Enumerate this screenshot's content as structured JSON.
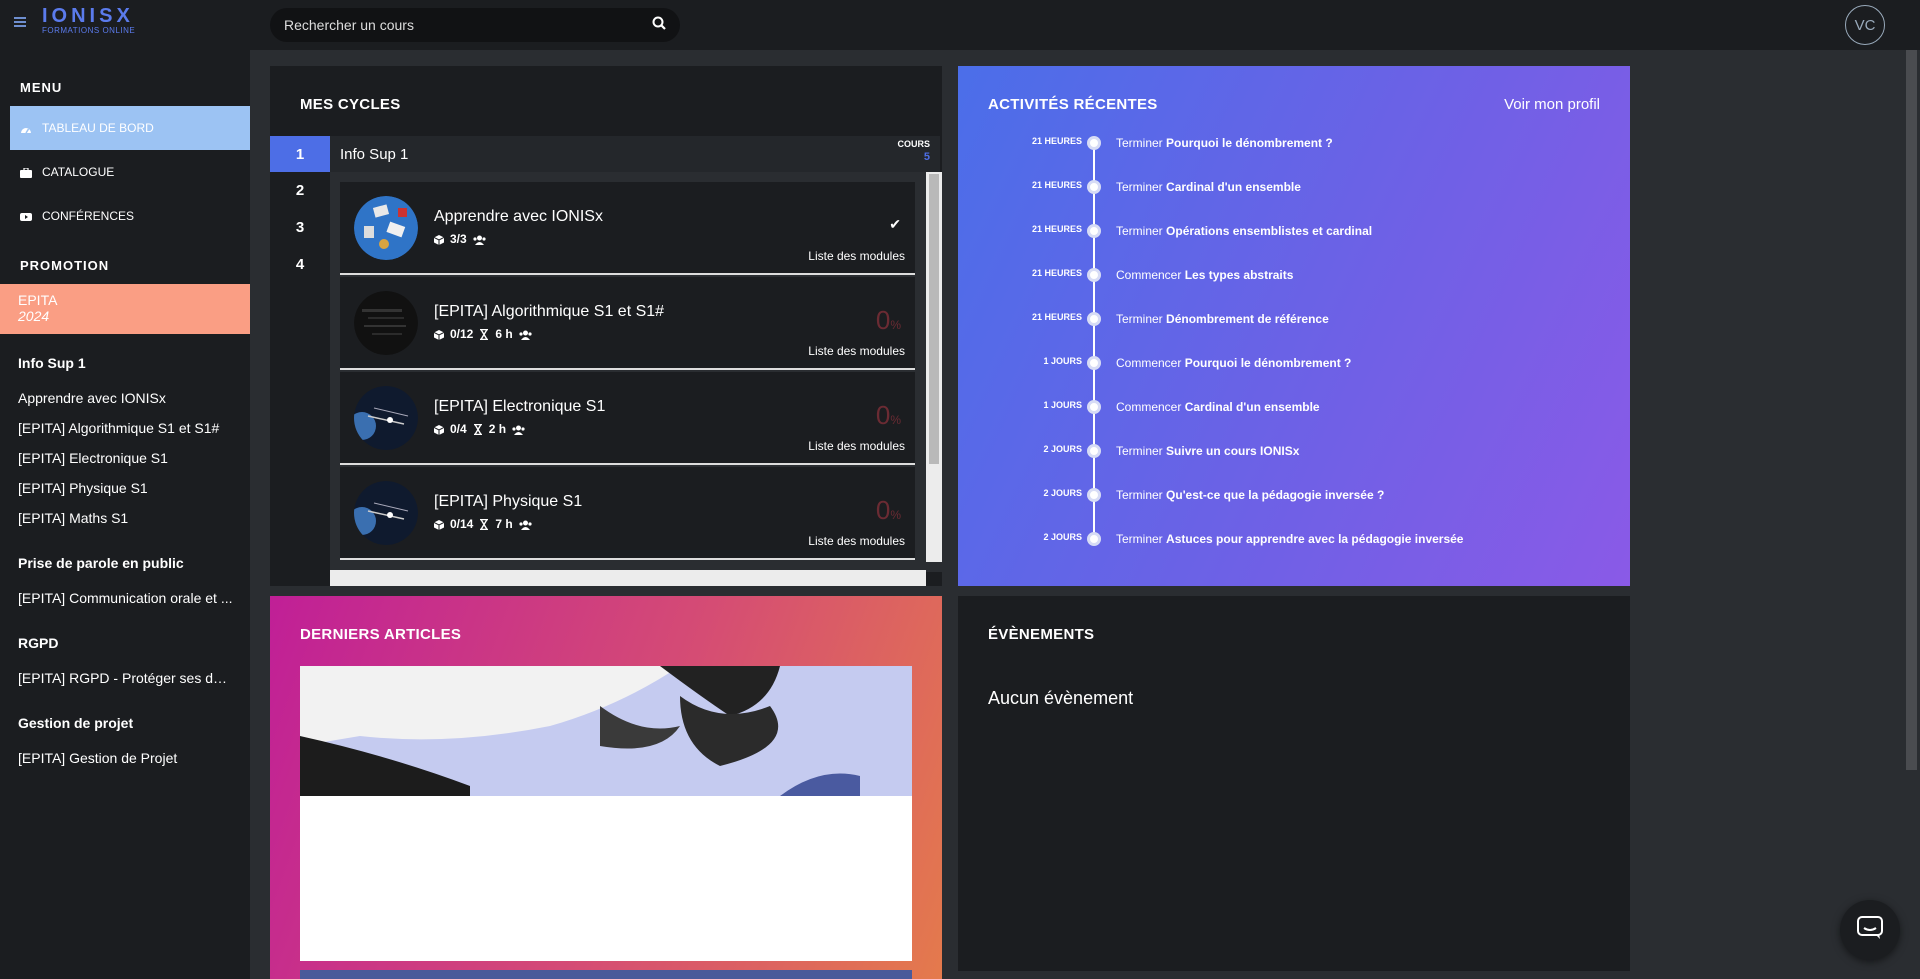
{
  "brand": {
    "name": "IONISX",
    "tagline": "FORMATIONS ONLINE",
    "accent": "#5b7bec"
  },
  "search": {
    "placeholder": "Rechercher un cours"
  },
  "user": {
    "initials": "VC"
  },
  "sidebar": {
    "menu_title": "MENU",
    "menu_items": [
      {
        "label": "TABLEAU DE BORD",
        "icon": "dashboard-icon",
        "active": true
      },
      {
        "label": "CATALOGUE",
        "icon": "catalog-icon",
        "active": false
      },
      {
        "label": "CONFÉRENCES",
        "icon": "video-icon",
        "active": false
      }
    ],
    "promotion_title": "PROMOTION",
    "promotion": {
      "school": "EPITA",
      "year": "2024"
    },
    "groups": [
      {
        "title": "Info Sup 1",
        "links": [
          "Apprendre avec IONISx",
          "[EPITA] Algorithmique S1 et S1#",
          "[EPITA] Electronique S1",
          "[EPITA] Physique S1",
          "[EPITA] Maths S1"
        ]
      },
      {
        "title": "Prise de parole en public",
        "links": [
          "[EPITA] Communication orale et ..."
        ]
      },
      {
        "title": "RGPD",
        "links": [
          "[EPITA] RGPD - Protéger ses don..."
        ]
      },
      {
        "title": "Gestion de projet",
        "links": [
          "[EPITA] Gestion de Projet"
        ]
      }
    ]
  },
  "cycles": {
    "title": "MES CYCLES",
    "tabs": [
      "1",
      "2",
      "3",
      "4"
    ],
    "active_cycle_name": "Info Sup 1",
    "cours_label": "COURS",
    "cours_count": "5",
    "courses": [
      {
        "title": "Apprendre avec IONISx",
        "modules": "3/3",
        "duration": "",
        "done": true,
        "progress": "",
        "link": "Liste des modules"
      },
      {
        "title": "[EPITA] Algorithmique S1 et S1#",
        "modules": "0/12",
        "duration": "6 h",
        "done": false,
        "progress": "0",
        "link": "Liste des modules"
      },
      {
        "title": "[EPITA] Electronique S1",
        "modules": "0/4",
        "duration": "2 h",
        "done": false,
        "progress": "0",
        "link": "Liste des modules"
      },
      {
        "title": "[EPITA] Physique S1",
        "modules": "0/14",
        "duration": "7 h",
        "done": false,
        "progress": "0",
        "link": "Liste des modules"
      }
    ],
    "percent_sign": "%"
  },
  "activities": {
    "title": "ACTIVITÉS RÉCENTES",
    "profile_link": "Voir mon profil",
    "items": [
      {
        "when": "21 HEURES",
        "verb": "Terminer",
        "target": "Pourquoi le dénombrement ?"
      },
      {
        "when": "21 HEURES",
        "verb": "Terminer",
        "target": "Cardinal d'un ensemble"
      },
      {
        "when": "21 HEURES",
        "verb": "Terminer",
        "target": "Opérations ensemblistes et cardinal"
      },
      {
        "when": "21 HEURES",
        "verb": "Commencer",
        "target": "Les types abstraits"
      },
      {
        "when": "21 HEURES",
        "verb": "Terminer",
        "target": "Dénombrement de référence"
      },
      {
        "when": "1 JOURS",
        "verb": "Commencer",
        "target": "Pourquoi le dénombrement ?"
      },
      {
        "when": "1 JOURS",
        "verb": "Commencer",
        "target": "Cardinal d'un ensemble"
      },
      {
        "when": "2 JOURS",
        "verb": "Terminer",
        "target": "Suivre un cours IONISx"
      },
      {
        "when": "2 JOURS",
        "verb": "Terminer",
        "target": "Qu'est-ce que la pédagogie inversée ?"
      },
      {
        "when": "2 JOURS",
        "verb": "Terminer",
        "target": "Astuces pour apprendre avec la pédagogie inversée"
      }
    ]
  },
  "articles": {
    "title": "DERNIERS ARTICLES"
  },
  "events": {
    "title": "ÉVÈNEMENTS",
    "empty": "Aucun évènement"
  }
}
